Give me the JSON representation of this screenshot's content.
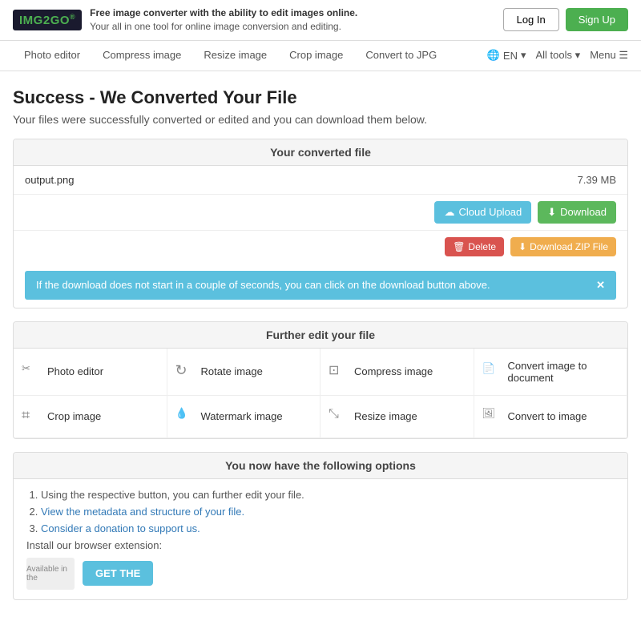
{
  "header": {
    "logo_text": "IMG",
    "logo_accent": "2",
    "logo_suffix": "GO",
    "tagline_title": "Free image converter with the ability to edit images online.",
    "tagline_sub": "Your all in one tool for online image conversion and editing.",
    "login_label": "Log In",
    "signup_label": "Sign Up"
  },
  "nav": {
    "links": [
      {
        "label": "Photo editor"
      },
      {
        "label": "Compress image"
      },
      {
        "label": "Resize image"
      },
      {
        "label": "Crop image"
      },
      {
        "label": "Convert to JPG"
      }
    ],
    "lang": "EN",
    "alltools": "All tools",
    "menu": "Menu"
  },
  "page": {
    "title": "Success - We Converted Your File",
    "subtitle": "Your files were successfully converted or edited and you can download them below."
  },
  "converted_section": {
    "header": "Your converted file",
    "file_name": "output.png",
    "file_size": "7.39 MB",
    "cloud_upload_label": "Cloud Upload",
    "download_label": "Download",
    "delete_label": "Delete",
    "zip_label": "Download ZIP File",
    "info_banner": "If the download does not start in a couple of seconds, you can click on the download button above.",
    "info_banner_close": "✕"
  },
  "edit_section": {
    "header": "Further edit your file",
    "items": [
      {
        "icon": "✂",
        "label": "Photo editor"
      },
      {
        "icon": "↻",
        "label": "Rotate image"
      },
      {
        "icon": "⊡",
        "label": "Compress image"
      },
      {
        "icon": "📄",
        "label": "Convert image to document"
      },
      {
        "icon": "✁",
        "label": "Crop image"
      },
      {
        "icon": "💧",
        "label": "Watermark image"
      },
      {
        "icon": "⤡",
        "label": "Resize image"
      },
      {
        "icon": "🖼",
        "label": "Convert to image"
      }
    ]
  },
  "options_section": {
    "header": "You now have the following options",
    "items": [
      {
        "text": "Using the respective button, you can further edit your file.",
        "link": null
      },
      {
        "text": "View the metadata and structure of your file.",
        "link": "View the metadata and structure of your file."
      },
      {
        "text": "Consider a donation to support us.",
        "link": "Consider a donation to support us."
      }
    ],
    "install_text": "Install our browser extension:",
    "available_text": "Available in the",
    "get_label": "GET THE"
  }
}
